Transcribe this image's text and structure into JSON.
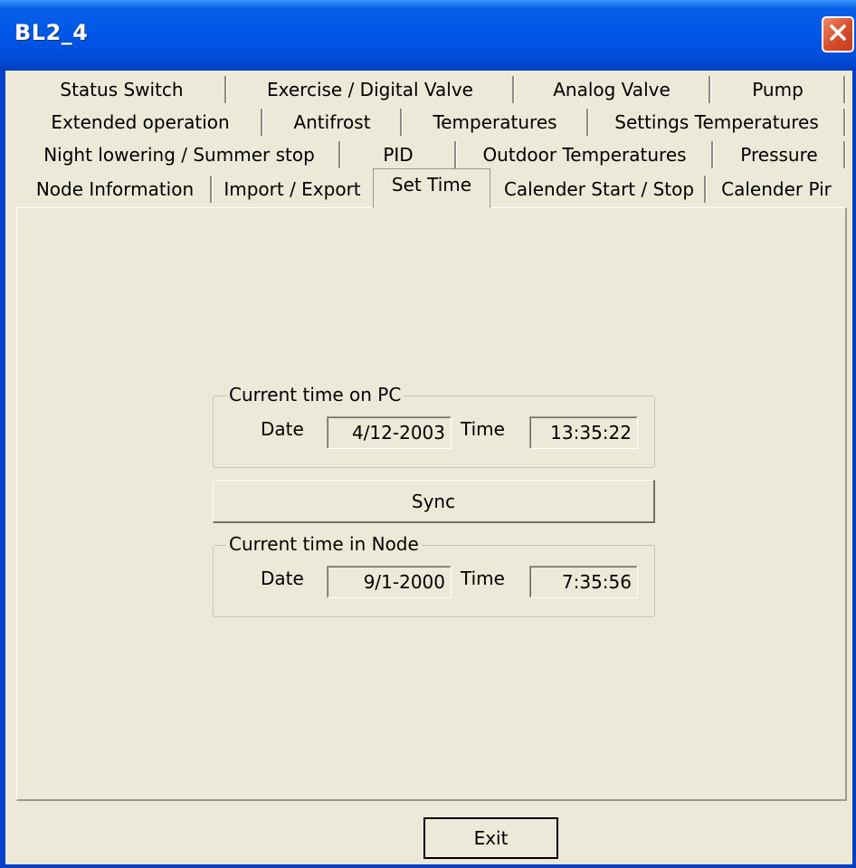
{
  "window": {
    "title": "BL2_4"
  },
  "tabs": {
    "row1": [
      "Status Switch",
      "Exercise / Digital Valve",
      "Analog Valve",
      "Pump"
    ],
    "row2": [
      "Extended operation",
      "Antifrost",
      "Temperatures",
      "Settings Temperatures"
    ],
    "row3": [
      "Night lowering / Summer stop",
      "PID",
      "Outdoor Temperatures",
      "Pressure"
    ],
    "row4": [
      "Node Information",
      "Import / Export",
      "Set Time",
      "Calender Start / Stop",
      "Calender Pir"
    ],
    "active": "Set Time"
  },
  "pc_time": {
    "legend": "Current time on PC",
    "date_label": "Date",
    "date_value": "4/12-2003",
    "time_label": "Time",
    "time_value": "13:35:22"
  },
  "sync_button": "Sync",
  "node_time": {
    "legend": "Current time in Node",
    "date_label": "Date",
    "date_value": "9/1-2000",
    "time_label": "Time",
    "time_value": "7:35:56"
  },
  "exit_button": "Exit"
}
